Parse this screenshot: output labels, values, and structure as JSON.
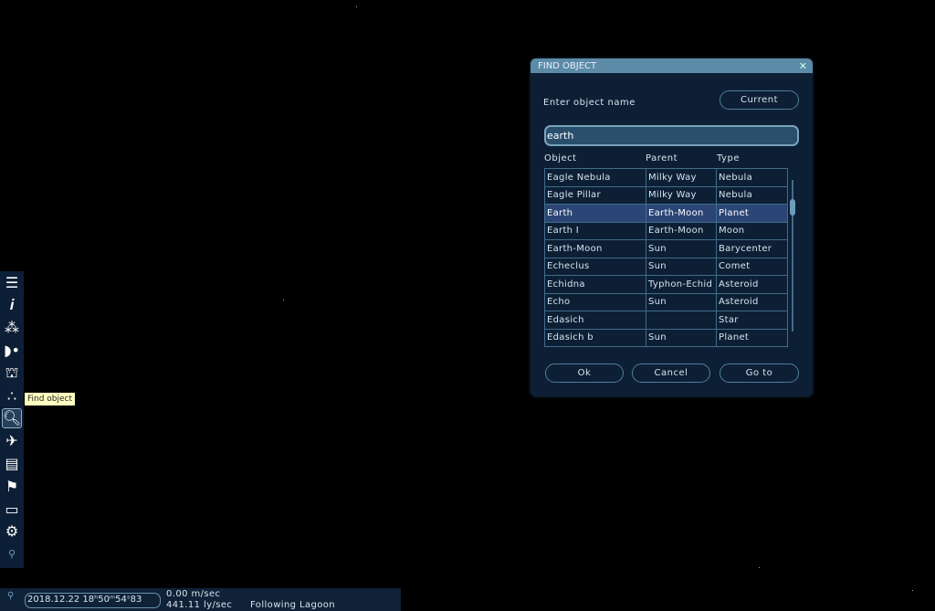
{
  "dialog": {
    "title": "FIND OBJECT",
    "close_icon": "close-icon",
    "label": "Enter object name",
    "current_label": "Current",
    "search_value": "earth",
    "columns": [
      "Object",
      "Parent",
      "Type"
    ],
    "rows": [
      [
        "Eagle Nebula",
        "Milky Way",
        "Nebula"
      ],
      [
        "Eagle Pillar",
        "Milky Way",
        "Nebula"
      ],
      [
        "Earth",
        "Earth-Moon",
        "Planet"
      ],
      [
        "Earth I",
        "Earth-Moon",
        "Moon"
      ],
      [
        "Earth-Moon",
        "Sun",
        "Barycenter"
      ],
      [
        "Echeclus",
        "Sun",
        "Comet"
      ],
      [
        "Echidna",
        "Typhon-Echid",
        "Asteroid"
      ],
      [
        "Echo",
        "Sun",
        "Asteroid"
      ],
      [
        "Edasich",
        "",
        "Star"
      ],
      [
        "Edasich b",
        "Sun",
        "Planet"
      ]
    ],
    "selected_row": 2,
    "ok_label": "Ok",
    "cancel_label": "Cancel",
    "goto_label": "Go to"
  },
  "toolbar": {
    "icons": [
      "menu-icon",
      "info-icon",
      "solar-system-icon",
      "planets-icon",
      "observatory-icon",
      "star-field-icon",
      "search-icon",
      "ship-icon",
      "journal-icon",
      "flag-icon",
      "display-icon",
      "settings-icon",
      "location-icon"
    ],
    "active": "search-icon",
    "tooltip": "Find object"
  },
  "status": {
    "location_icon": "location-pin-icon",
    "time": "2018.12.22 18ʰ50ᵐ54ˢ83",
    "speed": "0.00 m/sec",
    "speed2": "441.11 ly/sec",
    "following": "Following Lagoon"
  },
  "colors": {
    "panel": "#0d1f35",
    "title_bar": "#5b8ba6",
    "selection": "#2b4576",
    "tooltip": "#ffffc0"
  }
}
